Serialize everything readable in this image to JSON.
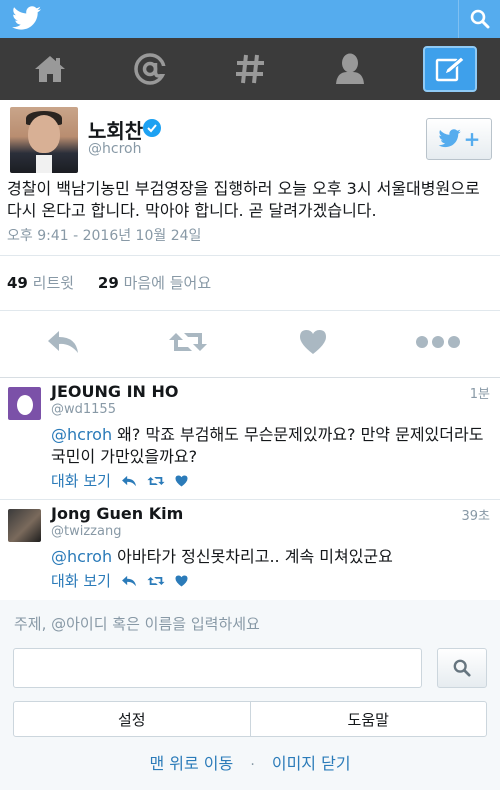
{
  "tweet": {
    "author_name": "노회찬",
    "author_handle": "@hcroh",
    "text": "경찰이 백남기농민 부검영장을 집행하러 오늘 오후 3시 서울대병원으로 다시 온다고 합니다. 막아야 합니다. 곧 달려가겠습니다.",
    "timestamp": "오후 9:41 - 2016년 10월 24일",
    "retweets_count": "49",
    "retweets_label": "리트윗",
    "likes_count": "29",
    "likes_label": "마음에 들어요"
  },
  "replies": [
    {
      "name": "JEOUNG IN HO",
      "handle": "@wd1155",
      "time": "1분",
      "mention": "@hcroh",
      "text": " 왜? 막죠 부검해도 무슨문제있까요? 만약 문제있더라도 국민이 가만있을까요?",
      "view_conversation": "대화 보기"
    },
    {
      "name": "Jong Guen Kim",
      "handle": "@twizzang",
      "time": "39초",
      "mention": "@hcroh",
      "text": " 아바타가 정신못차리고.. 계속 미쳐있군요",
      "view_conversation": "대화 보기"
    }
  ],
  "search": {
    "prompt": "주제, @아이디 혹은 이름을 입력하세요",
    "value": ""
  },
  "footer": {
    "settings_label": "설정",
    "help_label": "도움말",
    "back_to_top": "맨 위로 이동",
    "separator": "·",
    "hide_images": "이미지 닫기"
  },
  "colors": {
    "topbar": "#55acee",
    "navbar": "#3b3b3b",
    "compose_active": "#3ea0eb",
    "link": "#2b7bb9",
    "muted": "#8899a6"
  },
  "icons": {
    "topbar": [
      "twitter-bird-icon",
      "search-icon"
    ],
    "navbar": [
      "home-icon",
      "at-mentions-icon",
      "hashtag-icon",
      "profile-icon",
      "compose-icon"
    ],
    "tweet_actions": [
      "reply-icon",
      "retweet-icon",
      "like-icon",
      "more-icon"
    ]
  }
}
